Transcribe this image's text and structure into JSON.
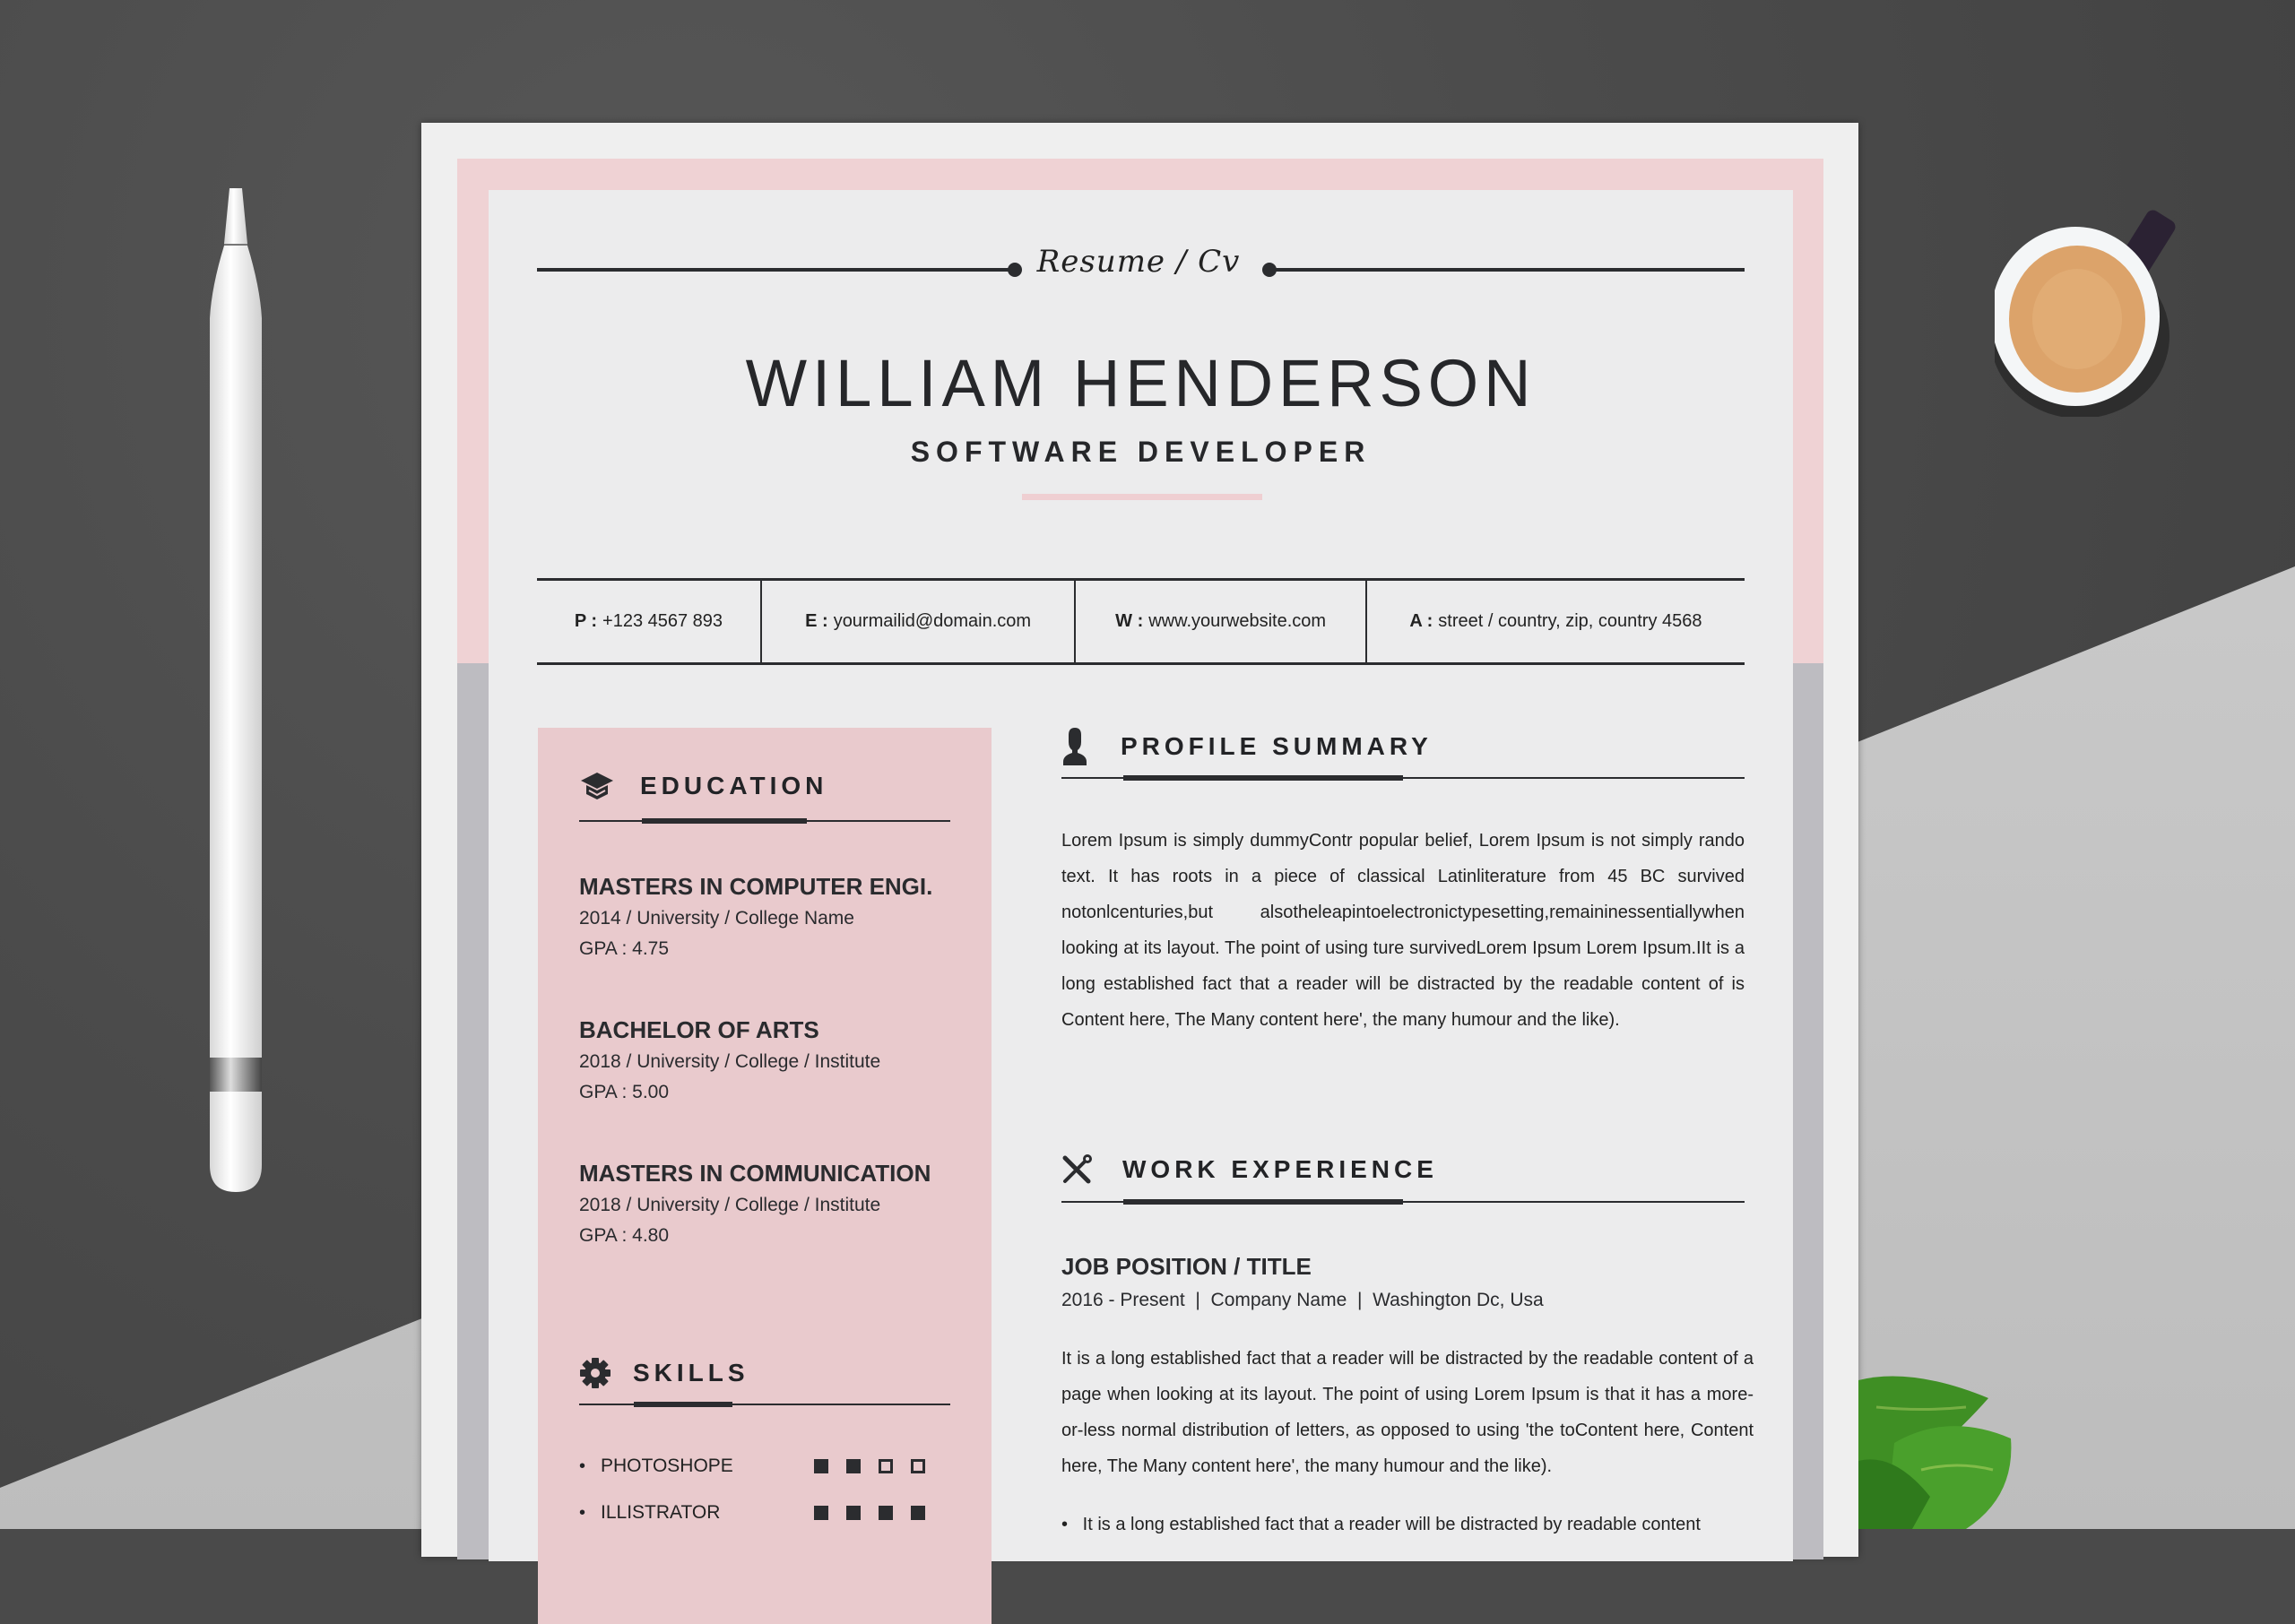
{
  "background": {
    "surface_colors": {
      "dark": "#4a4a4a",
      "concrete": "#c6c6c6"
    }
  },
  "resume": {
    "script_title": "Resume / Cv",
    "name": "WILLIAM HENDERSON",
    "role": "SOFTWARE DEVELOPER",
    "accent_color": "#efd2d4",
    "contact": [
      {
        "key": "P :",
        "value": "+123 4567 893"
      },
      {
        "key": "E :",
        "value": "yourmailid@domain.com"
      },
      {
        "key": "W :",
        "value": "www.yourwebsite.com"
      },
      {
        "key": "A :",
        "value": "street / country, zip, country 4568"
      }
    ],
    "education": {
      "heading": "EDUCATION",
      "icon": "graduation-cap-icon",
      "items": [
        {
          "degree": "MASTERS IN COMPUTER ENGI.",
          "detail": "2014 / University / College Name",
          "gpa": "GPA : 4.75"
        },
        {
          "degree": "BACHELOR OF ARTS",
          "detail": "2018 / University / College / Institute",
          "gpa": "GPA : 5.00"
        },
        {
          "degree": "MASTERS IN COMMUNICATION",
          "detail": "2018 / University / College / Institute",
          "gpa": "GPA : 4.80"
        }
      ]
    },
    "skills": {
      "heading": "SKILLS",
      "icon": "gear-icon",
      "items": [
        {
          "name": "PHOTOSHOPE",
          "level": 2,
          "max": 4
        },
        {
          "name": "ILLISTRATOR",
          "level": 4,
          "max": 4
        }
      ]
    },
    "profile": {
      "heading": "PROFILE SUMMARY",
      "icon": "user-icon",
      "text": "Lorem Ipsum is simply dummyContr popular belief, Lorem Ipsum is not simply rando text. It has roots in a piece of classical Latinliterature from 45 BC survived notonlcenturies,but alsotheleapintoelectronictypesetting,remaininessentiallywhen looking at its layout. The point of using ture survivedLorem Ipsum Lorem Ipsum.IIt is a long established fact that a reader will be distracted by the readable content of is Content here, The Many content here', the many humour and the like)."
    },
    "experience": {
      "heading": "WORK EXPERIENCE",
      "icon": "tools-icon",
      "jobs": [
        {
          "title": "JOB POSITION / TITLE",
          "meta": "2016 - Present  |  Company Name  |  Washington Dc, Usa",
          "description": "It is a long established fact that a reader will be distracted by the readable content of a page when looking at its layout. The point of using Lorem Ipsum is that it has a more-or-less normal distribution of letters, as opposed to using 'the toContent here, Content here, The Many content here', the many humour and the like).",
          "bullets": [
            "It is a long established fact that a reader will be distracted by readable content"
          ]
        }
      ]
    }
  }
}
